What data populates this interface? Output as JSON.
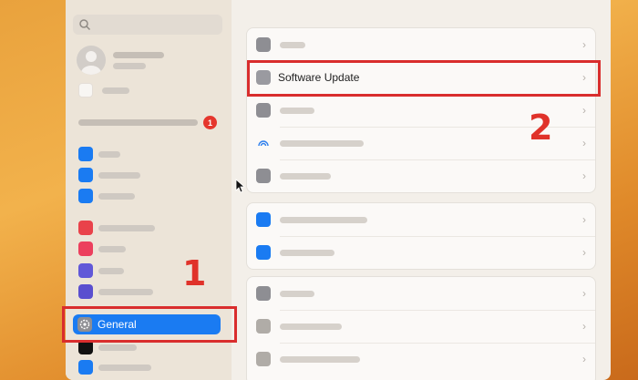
{
  "sidebar": {
    "badge_count": "1",
    "selected_item_label": "General"
  },
  "main": {
    "software_update_label": "Software Update",
    "chevron": "›"
  },
  "annotations": {
    "step1": "1",
    "step2": "2"
  },
  "colors": {
    "accent": "#1a7bf2",
    "annotation": "#d92d2d",
    "badge": "#e5362d"
  }
}
